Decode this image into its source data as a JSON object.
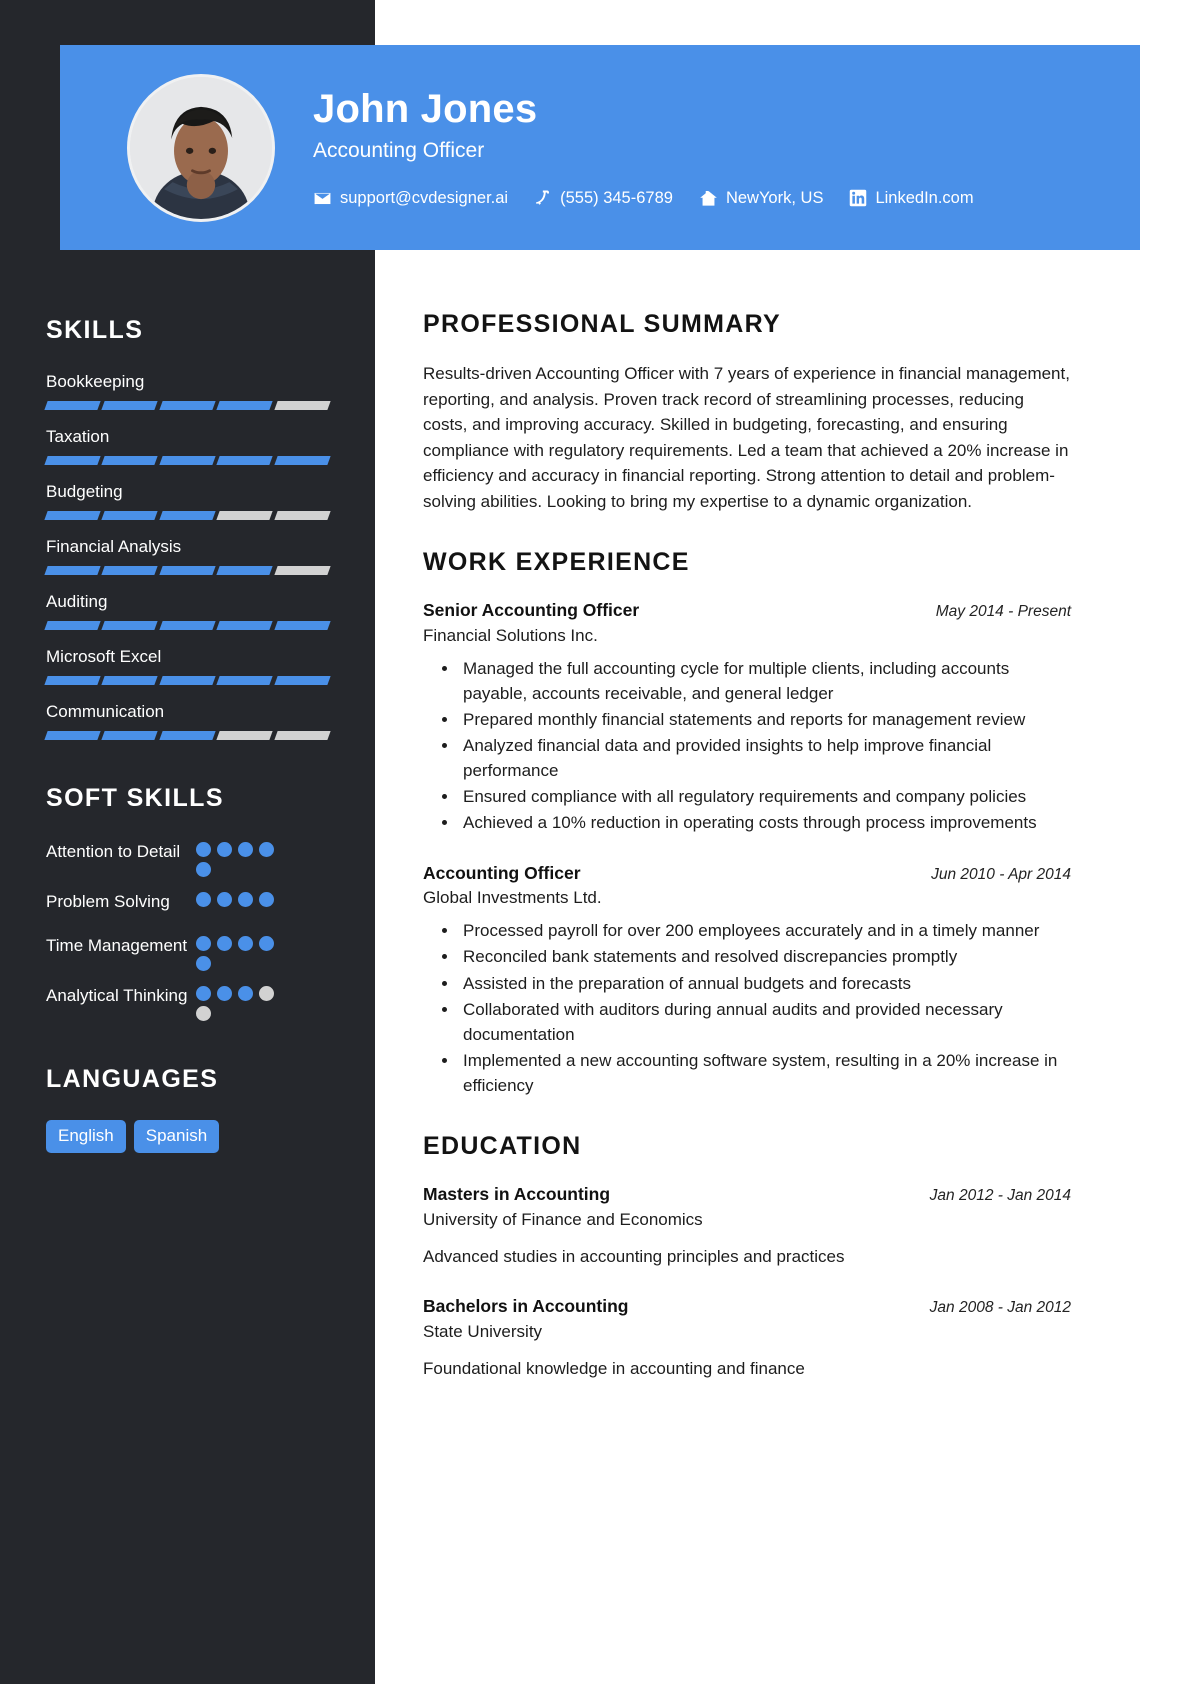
{
  "theme": {
    "accent": "#4a90e8",
    "sidebar_bg": "#25272c",
    "muted_bar": "#d2d2d2"
  },
  "header": {
    "name": "John Jones",
    "title": "Accounting Officer",
    "avatar_alt": "profile-photo",
    "contacts": [
      {
        "icon": "envelope-icon",
        "text": "support@cvdesigner.ai"
      },
      {
        "icon": "phone-icon",
        "text": "(555) 345-6789"
      },
      {
        "icon": "home-icon",
        "text": "NewYork, US"
      },
      {
        "icon": "linkedin-icon",
        "text": "LinkedIn.com"
      }
    ]
  },
  "sidebar": {
    "skills_heading": "SKILLS",
    "skills": [
      {
        "name": "Bookkeeping",
        "level": 4,
        "max": 5
      },
      {
        "name": "Taxation",
        "level": 5,
        "max": 5
      },
      {
        "name": "Budgeting",
        "level": 3,
        "max": 5
      },
      {
        "name": "Financial Analysis",
        "level": 4,
        "max": 5
      },
      {
        "name": "Auditing",
        "level": 5,
        "max": 5
      },
      {
        "name": "Microsoft Excel",
        "level": 5,
        "max": 5
      },
      {
        "name": "Communication",
        "level": 3,
        "max": 5
      }
    ],
    "soft_skills_heading": "SOFT SKILLS",
    "soft_skills": [
      {
        "name": "Attention to Detail",
        "level": 5,
        "max": 5
      },
      {
        "name": "Problem Solving",
        "level": 4,
        "max": 4
      },
      {
        "name": "Time Management",
        "level": 5,
        "max": 5
      },
      {
        "name": "Analytical Thinking",
        "level": 3,
        "max": 5
      }
    ],
    "languages_heading": "LANGUAGES",
    "languages": [
      "English",
      "Spanish"
    ]
  },
  "main": {
    "summary_heading": "PROFESSIONAL SUMMARY",
    "summary_text": "Results-driven Accounting Officer with 7 years of experience in financial management, reporting, and analysis. Proven track record of streamlining processes, reducing costs, and improving accuracy. Skilled in budgeting, forecasting, and ensuring compliance with regulatory requirements. Led a team that achieved a 20% increase in efficiency and accuracy in financial reporting. Strong attention to detail and problem-solving abilities. Looking to bring my expertise to a dynamic organization.",
    "experience_heading": "WORK EXPERIENCE",
    "experience": [
      {
        "title": "Senior Accounting Officer",
        "date": "May 2014 - Present",
        "org": "Financial Solutions Inc.",
        "bullets": [
          "Managed the full accounting cycle for multiple clients, including accounts payable, accounts receivable, and general ledger",
          "Prepared monthly financial statements and reports for management review",
          "Analyzed financial data and provided insights to help improve financial performance",
          "Ensured compliance with all regulatory requirements and company policies",
          "Achieved a 10% reduction in operating costs through process improvements"
        ]
      },
      {
        "title": "Accounting Officer",
        "date": "Jun 2010 - Apr 2014",
        "org": "Global Investments Ltd.",
        "bullets": [
          "Processed payroll for over 200 employees accurately and in a timely manner",
          "Reconciled bank statements and resolved discrepancies promptly",
          "Assisted in the preparation of annual budgets and forecasts",
          "Collaborated with auditors during annual audits and provided necessary documentation",
          "Implemented a new accounting software system, resulting in a 20% increase in efficiency"
        ]
      }
    ],
    "education_heading": "EDUCATION",
    "education": [
      {
        "degree": "Masters in Accounting",
        "date": "Jan 2012 - Jan 2014",
        "school": "University of Finance and Economics",
        "desc": "Advanced studies in accounting principles and practices"
      },
      {
        "degree": "Bachelors in Accounting",
        "date": "Jan 2008 - Jan 2012",
        "school": "State University",
        "desc": "Foundational knowledge in accounting and finance"
      }
    ]
  }
}
